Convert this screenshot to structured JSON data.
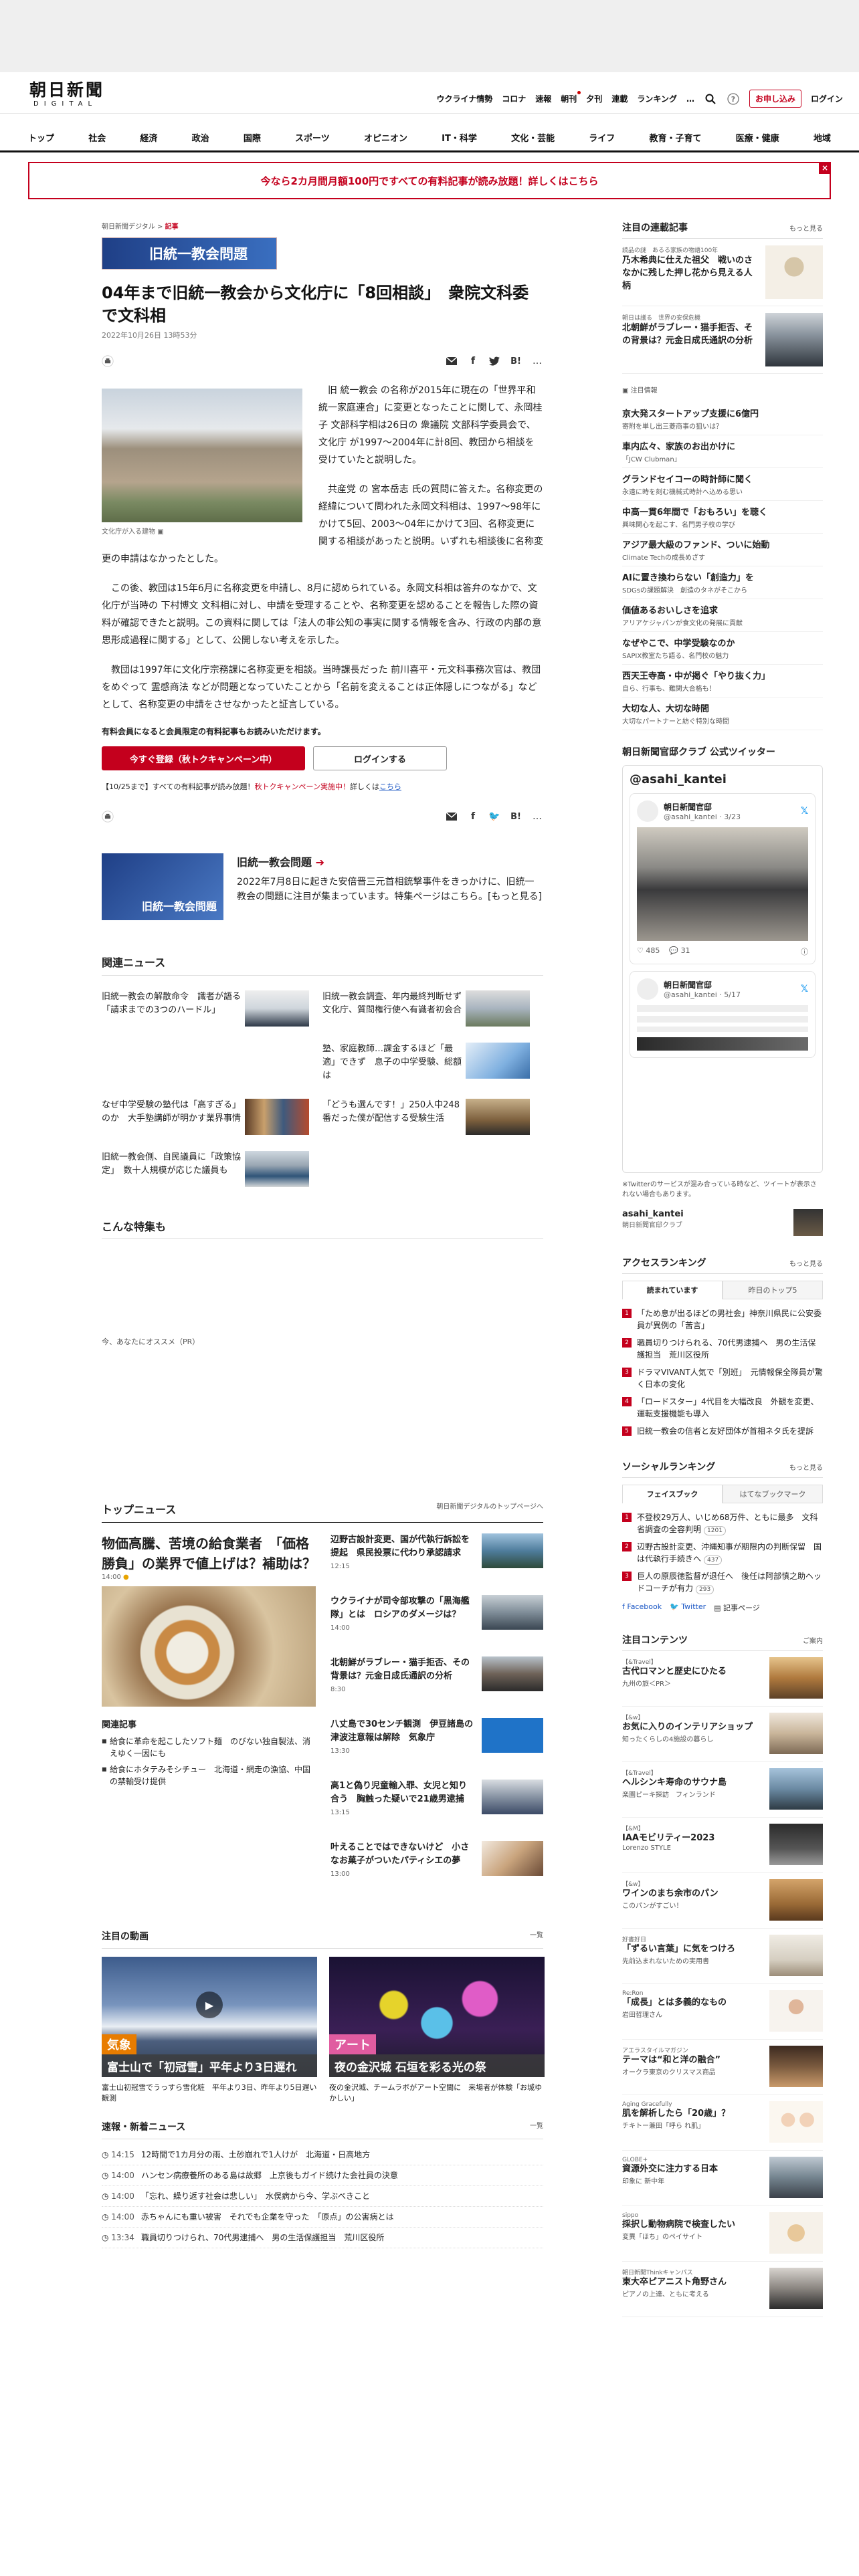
{
  "header": {
    "logo_main": "朝日新聞",
    "logo_sub": "DIGITAL",
    "util_links": [
      "ウクライナ情勢",
      "コロナ",
      "速報",
      "朝刊",
      "夕刊",
      "連載",
      "ランキング"
    ],
    "more": "…",
    "subscribe": "お申し込み",
    "login": "ログイン"
  },
  "nav": [
    "トップ",
    "社会",
    "経済",
    "政治",
    "国際",
    "スポーツ",
    "オピニオン",
    "IT・科学",
    "文化・芸能",
    "ライフ",
    "教育・子育て",
    "医療・健康",
    "地域"
  ],
  "banner": {
    "text": "今なら2カ月間月額100円ですべての有料記事が読み放題！詳しくはこちら",
    "close": "×"
  },
  "article": {
    "breadcrumb": {
      "site": "朝日新聞デジタル",
      "sep": ">",
      "current": "記事"
    },
    "topic_badge": "旧統一教会問題",
    "title": "04年まで旧統一教会から文化庁に「8回相談」　衆院文科委で文科相",
    "date": "2022年10月26日 13時53分",
    "list_label": "list",
    "photo_caption": "文化庁が入る建物",
    "paragraphs": [
      "旧 統一教会 の名称が2015年に現在の「世界平和統一家庭連合」に変更となったことに関して、永岡桂子 文部科学相は26日の 衆議院 文部科学委員会で、 文化庁 が1997～2004年に計8回、教団から相談を受けていたと説明した。",
      "共産党 の 宮本岳志 氏の質問に答えた。名称変更の経緯について問われた永岡文科相は、1997～98年にかけて5回、2003～04年にかけて3回、名称変更に関する相談があったと説明。いずれも相談後に名称変更の申請はなかったとした。",
      "この後、教団は15年6月に名称変更を申請し、8月に認められている。永岡文科相は答弁のなかで、文化庁が当時の 下村博文 文科相に対し、申請を受理することや、名称変更を認めることを報告した際の資料が確認できたと説明。この資料に関しては「法人の非公知の事実に関する情報を含み、行政の内部の意思形成過程に関する」として、公開しない考えを示した。",
      "教団は1997年に文化庁宗務課に名称変更を相談。当時課長だった 前川喜平・元文科事務次官は、教団をめぐって 霊感商法 などが問題となっていたことから「名前を変えることは正体隠しにつながる」などとして、名称変更の申請をさせなかったと証言している。"
    ],
    "member_note": "有料会員になると会員限定の有料記事もお読みいただけます。",
    "register_button": "今すぐ登録（秋トクキャンペーン中）",
    "login_button": "ログインする",
    "promo": {
      "prefix": "【10/25まで】すべての有料記事が読み放題！",
      "red": "秋トクキャンペーン実施中！",
      "mid": "詳しくは",
      "link": "こちら"
    }
  },
  "topic_feature": {
    "thumb_label": "旧統一教会問題",
    "title": "旧統一教会問題",
    "desc": "2022年7月8日に起きた安倍晋三元首相銃撃事件をきっかけに、旧統一教会の問題に注目が集まっています。特集ページはこちら。[もっと見る]"
  },
  "related_news": {
    "heading": "関連ニュース",
    "items": [
      "旧統一教会の解散命令　識者が語る「請求までの3つのハードル」",
      "旧統一教会調査、年内最終判断せず　文化庁、質問権行使へ有識者初会合",
      "",
      "塾、家庭教師…課金するほど「最適」できず　息子の中学受験、総額は",
      "なぜ中学受験の塾代は「高すぎる」のか　大手塾講師が明かす業界事情",
      "「どうも選んです！」250人中248番だった僕が配信する受験生活",
      "旧統一教会側、自民議員に「政策協定」　数十人規模が応じた議員も",
      ""
    ]
  },
  "special": {
    "heading": "こんな特集も",
    "pr": "今、あなたにオススメ（PR）"
  },
  "top_news": {
    "heading": "トップニュース",
    "link": "朝日新聞デジタルのトップページへ",
    "lead_title": "物価高騰、苦境の給食業者　「価格勝負」の業界で値上げは？補助は？",
    "lead_time": "14:00",
    "related_heading": "関連記事",
    "related": [
      "給食に革命を起こしたソフト麺　のびない独自製法、消えゆく一因にも",
      "給食にホタテみそシチュー　北海道・網走の漁協、中国の禁輸受け提供"
    ],
    "side": [
      {
        "title": "辺野古設計変更、国が代執行訴訟を提起　県民投票に代わり承認請求",
        "time": "12:15"
      },
      {
        "title": "ウクライナが司令部攻撃の「黒海艦隊」とは　ロシアのダメージは？",
        "time": "14:00"
      },
      {
        "title": "北朝鮮がラブレー・猫手拒否、その背景は？元金日成氏通訳の分析",
        "time": "8:30"
      },
      {
        "title": "八丈島で30センチ観測　伊豆諸島の津波注意報は解除　気象庁",
        "time": "13:30"
      },
      {
        "title": "高1と偽り児童輸入罪、女児と知り合う　胸触った疑いで21歳男逮捕",
        "time": "13:15"
      },
      {
        "title": "叶えることではできないけど　小さなお菓子がついたパティシエの夢",
        "time": "13:00"
      }
    ]
  },
  "videos": {
    "heading": "注目の動画",
    "more": "一覧",
    "items": [
      {
        "label": "気象",
        "bar": "富士山で「初冠雪」平年より3日遅れ",
        "caption": "富士山初冠雪でうっすら雪化粧　平年より3日、昨年より5日遅い観測"
      },
      {
        "label": "アート",
        "bar": "夜の金沢城 石垣を彩る光の祭",
        "caption": "夜の金沢城、チームラボがアート空間に　来場者が体験「お城ゆかしい」"
      }
    ]
  },
  "latest": {
    "heading": "速報・新着ニュース",
    "more": "一覧",
    "items": [
      {
        "time": "14:15",
        "text": "12時間で1カ月分の雨、土砂崩れで1人けが　北海道・日高地方"
      },
      {
        "time": "14:00",
        "text": "ハンセン病療養所のある島は故郷　上京後もガイド続けた会社員の決意"
      },
      {
        "time": "14:00",
        "text": "「忘れ、繰り返す社会は悲しい」　水俣病から今、学ぶべきこと"
      },
      {
        "time": "14:00",
        "text": "赤ちゃんにも重い被害　それでも企業を守った　「原点」の公害病とは"
      },
      {
        "time": "13:34",
        "text": "職員切りつけられ、70代男逮捕へ　男の生活保護担当　荒川区役所"
      }
    ]
  },
  "sidebar": {
    "serial": {
      "heading": "注目の連載記事",
      "more": "もっと見る",
      "items": [
        {
          "series": "読品の謎　あるる家族の物語100年",
          "title": "乃木希典に仕えた祖父　戦いのさなかに残した押し花から見える人柄"
        },
        {
          "series": "朝日は議る　世界の安保危機",
          "title": "北朝鮮がラブレー・猫手拒否、その背景は？元金日成氏通訳の分析"
        }
      ]
    },
    "ad_label": "注目情報",
    "ad_items": [
      {
        "title": "京大発スタートアップ支援に6億円",
        "sub": "寄附を単し出三菱商事の狙いは？"
      },
      {
        "title": "車内広々、家族のお出かけに",
        "sub": "「JCW Clubman」"
      },
      {
        "title": "グランドセイコーの時計師に聞く",
        "sub": "永遠に時を刻む機械式時計へ込める思い"
      },
      {
        "title": "中高一貫6年間で「おもろい」を聴く",
        "sub": "興味関心を起こす、名門男子校の学び"
      },
      {
        "title": "アジア最大級のファンド、ついに始動",
        "sub": "Climate Techの成長めざす"
      },
      {
        "title": "AIに置き換わらない「創造力」を",
        "sub": "SDGsの課題解決　創造のタネがそこから"
      },
      {
        "title": "価値あるおいしさを追求",
        "sub": "アリアケジャパンが食文化の発展に貢献"
      },
      {
        "title": "なぜやこで、中学受験なのか",
        "sub": "SAPIX教室たち語る、名門校の魅力"
      },
      {
        "title": "西天王寺高・中が掲ぐ「やり抜く力」",
        "sub": "自ら、行事も、難関大合格も！"
      },
      {
        "title": "大切な人、大切な時間",
        "sub": "大切なパートナーと紡ぐ特別な時間"
      }
    ],
    "twitter": {
      "heading": "朝日新聞官邸クラブ 公式ツイッター",
      "box_title": "@asahi_kantei",
      "t1_name": "朝日新聞官邸",
      "t1_handle": "@asahi_kantei · 3/23",
      "t1_likes": "485",
      "t1_replies": "31",
      "t2_name": "朝日新聞官邸",
      "t2_handle": "@asahi_kantei · 5/17",
      "note": "※Twitterのサービスが混み合っている時など、ツイートが表示されない場合もあります。",
      "acct": "asahi_kantei",
      "acct_desc": "朝日新聞官邸クラブ"
    },
    "access": {
      "heading": "アクセスランキング",
      "more": "もっと見る",
      "tabs": [
        "読まれています",
        "昨日のトップ5"
      ],
      "items": [
        "「ため息が出るほどの男社会」神奈川県民に公安委員が異例の「苦言」",
        "職員切りつけられる、70代男逮捕へ　男の生活保護担当　荒川区役所",
        "ドラマVIVANT人気で「別班」　元情報保全隊員が驚く日本の変化",
        "「ロードスター」4代目を大幅改良　外観を変更、運転支援機能も導入",
        "旧統一教会の信者と友好団体が首相ネタ氏を提訴"
      ]
    },
    "social": {
      "heading": "ソーシャルランキング",
      "more": "もっと見る",
      "tabs": [
        "フェイスブック",
        "はてなブックマーク"
      ],
      "items": [
        {
          "text": "不登校29万人、いじめ68万件、ともに最多　文科省調査の全容判明",
          "count": "1201"
        },
        {
          "text": "辺野古設計変更、沖縄知事が期限内の判断保留　国は代執行手続きへ",
          "count": "437"
        },
        {
          "text": "巨人の原辰徳監督が退任へ　後任は阿部慎之助ヘッドコーチが有力",
          "count": "293"
        }
      ],
      "follow": [
        "Facebook",
        "Twitter",
        "記事ページ"
      ]
    },
    "attention": {
      "heading": "注目コンテンツ",
      "more": "ご案内",
      "items": [
        {
          "src": "【&Travel】",
          "title": "古代ロマンと歴史にひたる",
          "sub": "九州の旅＜PR＞"
        },
        {
          "src": "【&w】",
          "title": "お気に入りのインテリアショップ",
          "sub": "知ったくらしの4施設の暮らし"
        },
        {
          "src": "【&Travel】",
          "title": "ヘルシンキ寿命のサウナ島",
          "sub": "楽園ピーキ探訪　フィンランド"
        },
        {
          "src": "【&M】",
          "title": "IAAモビリティー2023",
          "sub": "Lorenzo STYLE"
        },
        {
          "src": "【&w】",
          "title": "ワインのまち余市のパン",
          "sub": "このパンがすごい！"
        },
        {
          "src": "好書好日",
          "title": "「ずるい言葉」に気をつけろ",
          "sub": "先前込まれないための実用書"
        },
        {
          "src": "Re:Ron",
          "title": "「成長」とは多義的なもの",
          "sub": "岩田哲理さん"
        },
        {
          "src": "アエラスタイルマガジン",
          "title": "テーマは“和と洋の融合”",
          "sub": "オークラ東京のクリスマス商品"
        },
        {
          "src": "Aging Gracefully",
          "title": "肌を解析したら「20歳」？",
          "sub": "チキトー兼田「呼ら れ肌」"
        },
        {
          "src": "GLOBE+",
          "title": "資源外交に注力する日本",
          "sub": "印象に 新中年"
        },
        {
          "src": "sippo",
          "title": "採択し動物病院で検査したい",
          "sub": "変異「ほち」のペイサイト"
        },
        {
          "src": "朝日新聞Thinkキャンパス",
          "title": "東大卒ピアニスト角野さん",
          "sub": "ピアノの上達、ともに考える"
        }
      ]
    }
  },
  "colors": {
    "brand_red": "#c4001d",
    "link_blue": "#1a56c4",
    "topic_blue": "#1f3f86"
  }
}
